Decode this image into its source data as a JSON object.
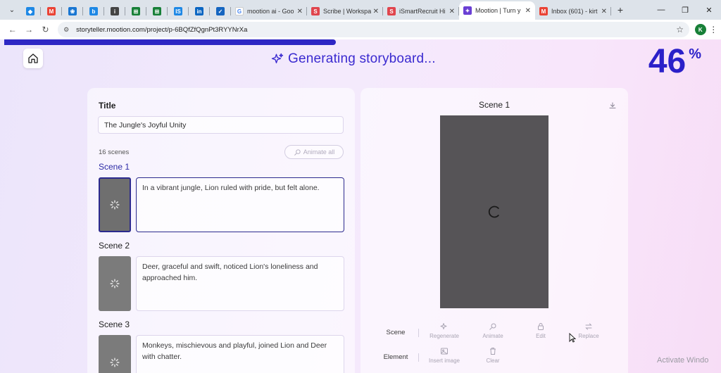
{
  "browser": {
    "tabs": [
      {
        "type": "pin",
        "icon": "diamond-icon",
        "color": "#1e88e5"
      },
      {
        "type": "pin",
        "icon": "gmail-icon",
        "color": "#ea4335"
      },
      {
        "type": "pin",
        "icon": "gift-icon",
        "color": "#1976d2"
      },
      {
        "type": "pin",
        "icon": "b-icon",
        "color": "#1e88e5"
      },
      {
        "type": "pin",
        "icon": "info-icon",
        "color": "#444444"
      },
      {
        "type": "pin",
        "icon": "sheets-icon",
        "color": "#188038"
      },
      {
        "type": "pin",
        "icon": "sheets-icon",
        "color": "#188038"
      },
      {
        "type": "pin",
        "icon": "is-icon",
        "color": "#1e88e5"
      },
      {
        "type": "pin",
        "icon": "linkedin-icon",
        "color": "#0a66c2"
      },
      {
        "type": "pin",
        "icon": "check-icon",
        "color": "#1565c0"
      },
      {
        "type": "full",
        "title": "mootion ai - Goo",
        "icon": "google-icon",
        "color": "#ffffff"
      },
      {
        "type": "full",
        "title": "Scribe | Workspa",
        "icon": "scribe-icon",
        "color": "#e0454d"
      },
      {
        "type": "full",
        "title": "iSmartRecruit Hi",
        "icon": "ismart-icon",
        "color": "#e0454d"
      },
      {
        "type": "full",
        "title": "Mootion | Turn y",
        "icon": "mootion-icon",
        "color": "#6a3fd4",
        "active": true
      },
      {
        "type": "full",
        "title": "Inbox (601) - kirt",
        "icon": "gmail-icon",
        "color": "#ea4335"
      }
    ],
    "url": "storyteller.mootion.com/project/p-6BQfZfQgnPt3RYYNrXa",
    "profile_initial": "K"
  },
  "header": {
    "title": "Generating storyboard...",
    "percent": "46",
    "percent_sign": "%",
    "progress": 0.46
  },
  "story": {
    "title_label": "Title",
    "title_value": "The Jungle's Joyful Unity",
    "scene_count": "16 scenes",
    "animate_all_label": "Animate all",
    "scenes": [
      {
        "label": "Scene 1",
        "text": "In a vibrant jungle, Lion ruled with pride, but felt alone.",
        "active": true
      },
      {
        "label": "Scene 2",
        "text": "Deer, graceful and swift, noticed Lion's loneliness and approached him.",
        "active": false
      },
      {
        "label": "Scene 3",
        "text": "Monkeys, mischievous and playful, joined Lion and Deer with chatter.",
        "active": false
      }
    ]
  },
  "preview": {
    "title": "Scene 1",
    "scene_row_label": "Scene",
    "element_row_label": "Element",
    "actions": {
      "regenerate": "Regenerate",
      "animate": "Animate",
      "edit": "Edit",
      "replace": "Replace",
      "insert_image": "Insert image",
      "clear": "Clear"
    }
  },
  "watermark": "Activate Windo"
}
